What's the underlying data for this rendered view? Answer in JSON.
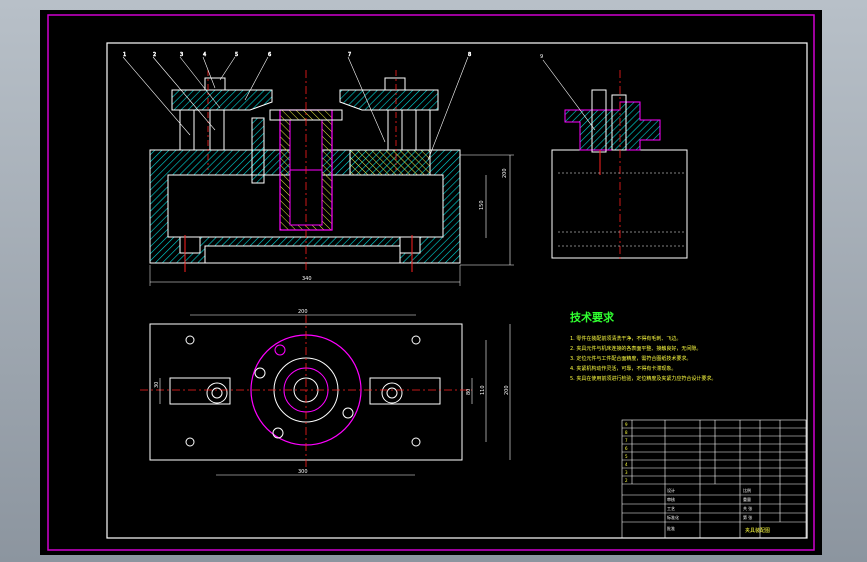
{
  "drawing": {
    "balloons_front": [
      "1",
      "2",
      "3",
      "4",
      "5",
      "6",
      "7",
      "8"
    ],
    "balloon_side": "9",
    "dim_front_width": "340",
    "dim_front_height": "200",
    "dim_front_inner": "150",
    "dim_top_upper": "200",
    "dim_top_lower": "300",
    "dim_top_right1": "80",
    "dim_top_right2": "110",
    "dim_top_right3": "200",
    "dim_top_left": "30"
  },
  "tech": {
    "title": "技术要求",
    "items": [
      "1. 零件在装配前须清洗干净，不得有毛刺、飞边。",
      "2. 夹具元件与机床连接的各表面平整、接触良好，无间隙。",
      "3. 定位元件与工件配合面精度，需符合图纸技术要求。",
      "4. 夹紧机构动作灵活，可靠，不得有卡滞现象。",
      "5. 夹具在使用前须进行检验，定位精度及夹紧力应符合设计要求。"
    ]
  },
  "title_block": {
    "drawing_name": "夹具装配图",
    "rows": [
      "9",
      "8",
      "7",
      "6",
      "5",
      "4",
      "3",
      "2",
      "1"
    ],
    "labels": [
      "设计",
      "审核",
      "工艺",
      "标准化",
      "批准",
      "比例",
      "重量",
      "共 张",
      "第 张"
    ]
  },
  "colors": {
    "line": "#ffffff",
    "hatch": "#00e5e5",
    "part": "#ff00ff",
    "red": "#ff2020",
    "yellow": "#ffff40",
    "green": "#30ff30",
    "balloon": "#ffffff"
  }
}
